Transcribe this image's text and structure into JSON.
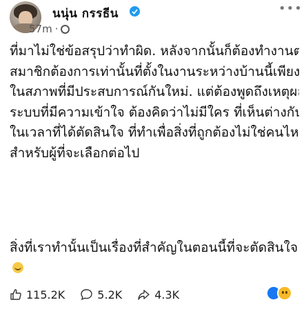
{
  "post": {
    "username": "นนุ่น กรรธีน",
    "time": "57m",
    "more_label": "•••",
    "body_lines": [
      "ที่มาไม่ใช่ข้อสรุปว่าทำผิด. หลังจากนั้นก็ต้องทำงานต่อ",
      "สมาชิกต้องการเท่านั้นที่ตั้งในงานระหว่างบ้านนี้เพียงพอ",
      "ในสภาพที่มีประสบการณ์กันใหม่. แต่ต้องพูดถึงเหตุผลที่เปลี่ยน",
      "ระบบที่มีความเข้าใจ ต้องคิดว่าไม่มีใคร ที่เห็นต่างกัน",
      "ในเวลาที่ได้ตัดสินใจ ที่ทำเพื่อสิ่งที่ถูกต้องไม่ใช่คนไหน",
      "สำหรับผู้ที่จะเลือกต่อไป"
    ],
    "second_lines": [
      "สิ่งที่เราทำนั้นเป็นเรื่องที่สำคัญในตอนนี้ที่จะตัดสินใจ"
    ],
    "icons": {
      "verified": "verified-badge-icon",
      "globe": "globe-icon",
      "like": "thumbs-up-icon",
      "comment": "comment-icon",
      "share": "share-icon",
      "emoji": "grinning-face-icon"
    },
    "colors": {
      "verified": "#1d9bf0",
      "like_reaction": "#1877f2",
      "haha_reaction": "#f7b928"
    }
  },
  "actions": {
    "likes": "115.2K",
    "comments": "5.2K",
    "shares": "4.3K"
  }
}
